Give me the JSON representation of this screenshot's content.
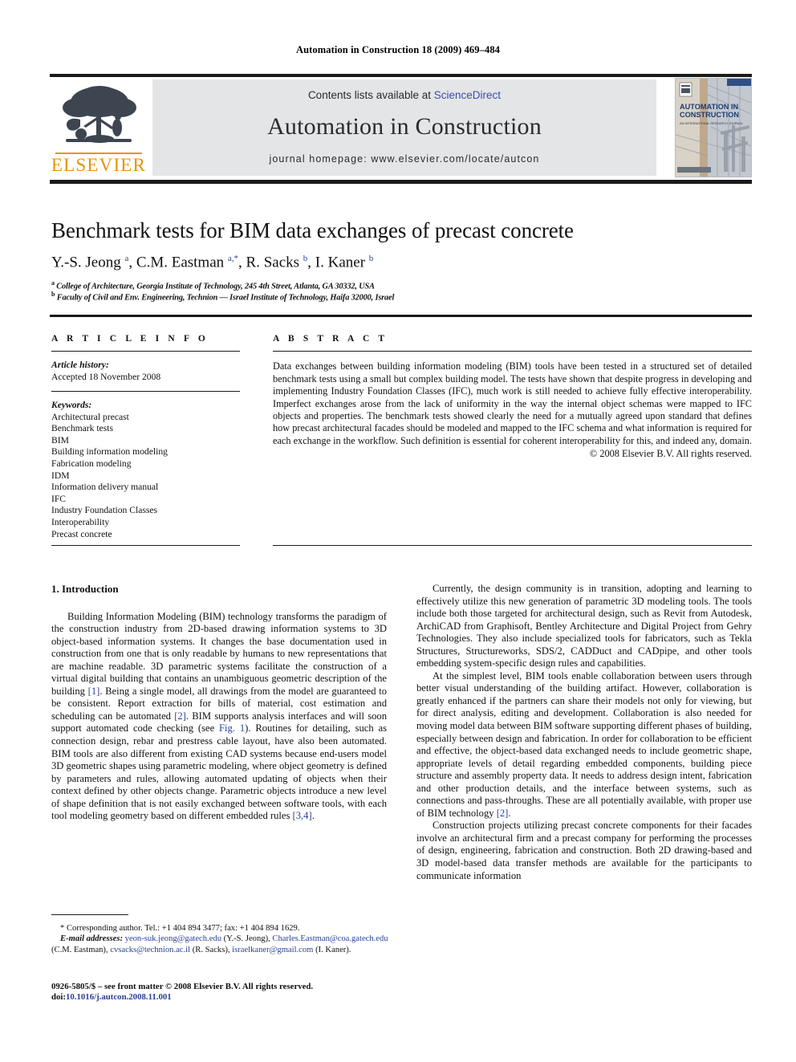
{
  "running_head": "Automation in Construction 18 (2009) 469–484",
  "masthead": {
    "contents_prefix": "Contents lists available at ",
    "sciencedirect": "ScienceDirect",
    "journal_title": "Automation in Construction",
    "homepage": "journal homepage: www.elsevier.com/locate/autcon",
    "publisher_name": "ELSEVIER",
    "cover_title_line1": "AUTOMATION IN",
    "cover_title_line2": "CONSTRUCTION",
    "cover_subtitle": "AN INTERNATIONAL RESEARCH JOURNAL",
    "accent_orange": "#e8920a",
    "link_blue": "#3a4ea8",
    "band_gray": "#e4e5e7"
  },
  "article": {
    "title": "Benchmark tests for BIM data exchanges of precast concrete",
    "authors_html": "Y.-S. Jeong <sup>a</sup>, C.M. Eastman <sup>a,*</sup>, R. Sacks <sup>b</sup>, I. Kaner <sup>b</sup>",
    "affiliation_a": "College of Architecture, Georgia Institute of Technology, 245 4th Street, Atlanta, GA 30332, USA",
    "affiliation_b": "Faculty of Civil and Env. Engineering, Technion — Israel Institute of Technology, Haifa 32000, Israel"
  },
  "article_info": {
    "heading": "A R T I C L E    I N F O",
    "history_label": "Article history:",
    "history_value": "Accepted 18 November 2008",
    "keywords_label": "Keywords:",
    "keywords": [
      "Architectural precast",
      "Benchmark tests",
      "BIM",
      "Building information modeling",
      "Fabrication modeling",
      "IDM",
      "Information delivery manual",
      "IFC",
      "Industry Foundation Classes",
      "Interoperability",
      "Precast concrete"
    ]
  },
  "abstract": {
    "heading": "A B S T R A C T",
    "text": "Data exchanges between building information modeling (BIM) tools have been tested in a structured set of detailed benchmark tests using a small but complex building model. The tests have shown that despite progress in developing and implementing Industry Foundation Classes (IFC), much work is still needed to achieve fully effective interoperability. Imperfect exchanges arose from the lack of uniformity in the way the internal object schemas were mapped to IFC objects and properties. The benchmark tests showed clearly the need for a mutually agreed upon standard that defines how precast architectural facades should be modeled and mapped to the IFC schema and what information is required for each exchange in the workflow. Such definition is essential for coherent interoperability for this, and indeed any, domain.",
    "copyright": "© 2008 Elsevier B.V. All rights reserved."
  },
  "body": {
    "section_heading": "1. Introduction",
    "left_paragraphs": [
      "Building Information Modeling (BIM) technology transforms the paradigm of the construction industry from 2D-based drawing information systems to 3D object-based information systems. It changes the base documentation used in construction from one that is only readable by humans to new representations that are machine readable. 3D parametric systems facilitate the construction of a virtual digital building that contains an unambiguous geometric description of the building [1]. Being a single model, all drawings from the model are guaranteed to be consistent. Report extraction for bills of material, cost estimation and scheduling can be automated [2]. BIM supports analysis interfaces and will soon support automated code checking (see Fig. 1). Routines for detailing, such as connection design, rebar and prestress cable layout, have also been automated. BIM tools are also different from existing CAD systems because end-users model 3D geometric shapes using parametric modeling, where object geometry is defined by parameters and rules, allowing automated updating of objects when their context defined by other objects change. Parametric objects introduce a new level of shape definition that is not easily exchanged between software tools, with each tool modeling geometry based on different embedded rules [3,4]."
    ],
    "right_paragraphs": [
      "Currently, the design community is in transition, adopting and learning to effectively utilize this new generation of parametric 3D modeling tools. The tools include both those targeted for architectural design, such as Revit from Autodesk, ArchiCAD from Graphisoft, Bentley Architecture and Digital Project from Gehry Technologies. They also include specialized tools for fabricators, such as Tekla Structures, Structureworks, SDS/2, CADDuct and CADpipe, and other tools embedding system-specific design rules and capabilities.",
      "At the simplest level, BIM tools enable collaboration between users through better visual understanding of the building artifact. However, collaboration is greatly enhanced if the partners can share their models not only for viewing, but for direct analysis, editing and development. Collaboration is also needed for moving model data between BIM software supporting different phases of building, especially between design and fabrication. In order for collaboration to be efficient and effective, the object-based data exchanged needs to include geometric shape, appropriate levels of detail regarding embedded components, building piece structure and assembly property data. It needs to address design intent, fabrication and other production details, and the interface between systems, such as connections and pass-throughs. These are all potentially available, with proper use of BIM technology [2].",
      "Construction projects utilizing precast concrete components for their facades involve an architectural firm and a precast company for performing the processes of design, engineering, fabrication and construction. Both 2D drawing-based and 3D model-based data transfer methods are available for the participants to communicate information"
    ]
  },
  "footnote": {
    "corresponding": "* Corresponding author. Tel.: +1 404 894 3477; fax: +1 404 894 1629.",
    "email_label": "E-mail addresses:",
    "emails": [
      {
        "address": "yeon-suk.jeong@gatech.edu",
        "person": "(Y.-S. Jeong),"
      },
      {
        "address": "Charles.Eastman@coa.gatech.edu",
        "person": "(C.M. Eastman),"
      },
      {
        "address": "cvsacks@technion.ac.il",
        "person": "(R. Sacks),"
      },
      {
        "address": "israelkaner@gmail.com",
        "person": "(I. Kaner)."
      }
    ],
    "imprint": "0926-5805/$ – see front matter © 2008 Elsevier B.V. All rights reserved.",
    "doi_label": "doi:",
    "doi_value": "10.1016/j.autcon.2008.11.001"
  }
}
